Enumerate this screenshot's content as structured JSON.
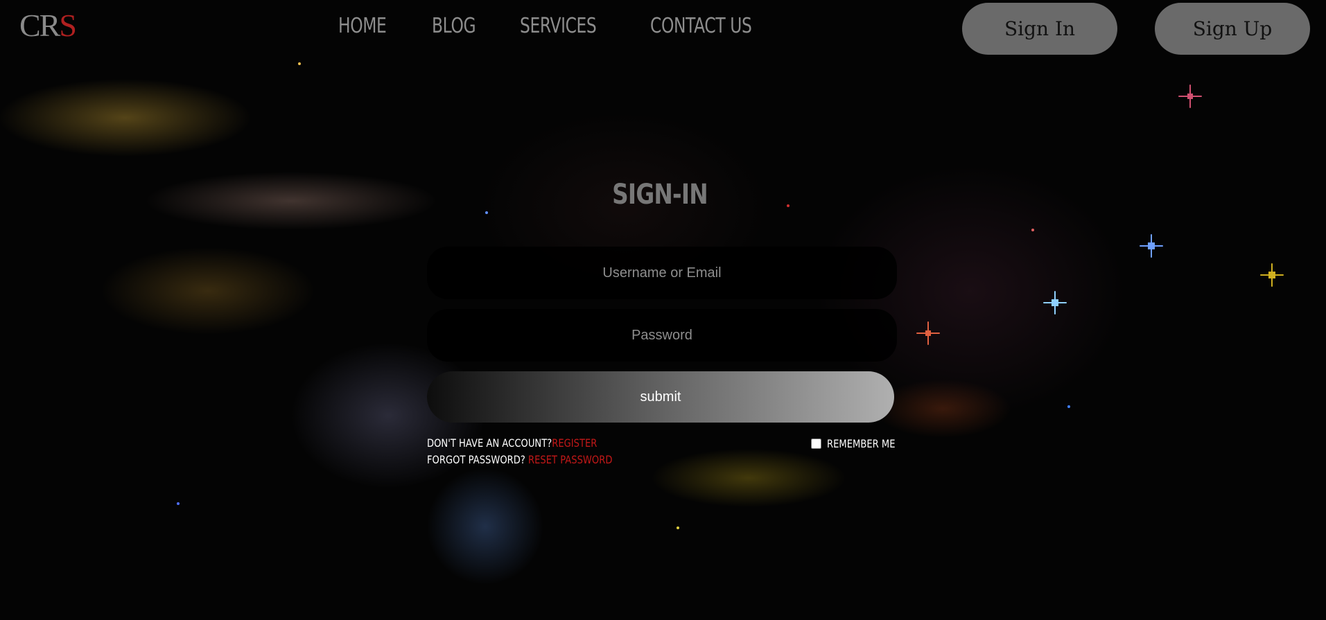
{
  "header": {
    "logo": {
      "text_main": "CR",
      "text_accent": "S"
    },
    "nav": [
      {
        "label": "HOME"
      },
      {
        "label": "BLOG"
      },
      {
        "label": "SERVICES"
      },
      {
        "label": "CONTACT US"
      }
    ],
    "sign_in_label": "Sign In",
    "sign_up_label": "Sign Up"
  },
  "form": {
    "title": "SIGN-IN",
    "username": {
      "placeholder": "Username or Email",
      "value": ""
    },
    "password": {
      "placeholder": "Password",
      "value": ""
    },
    "submit_label": "submit",
    "no_account_text": "DON'T HAVE AN ACCOUNT?",
    "register_label": "REGISTER",
    "forgot_text": "FORGOT PASSWORD? ",
    "reset_label": "RESET PASSWORD",
    "remember_label": "REMEMBER ME",
    "remember_checked": false
  },
  "colors": {
    "accent_red": "#c41818",
    "button_gray": "#6a6a6a"
  }
}
